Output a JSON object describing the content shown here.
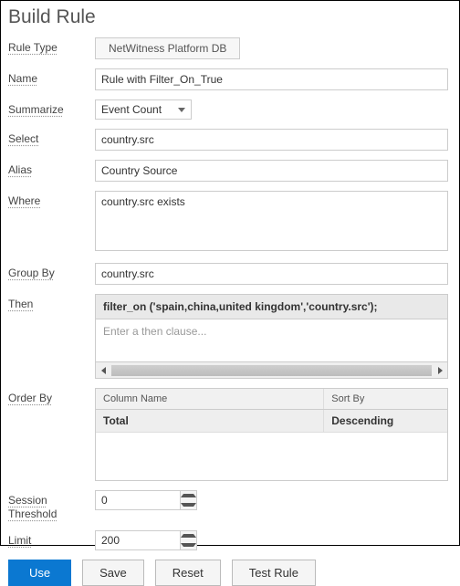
{
  "title": "Build Rule",
  "labels": {
    "ruleType": "Rule Type",
    "name": "Name",
    "summarize": "Summarize",
    "select": "Select",
    "alias": "Alias",
    "where": "Where",
    "groupBy": "Group By",
    "then": "Then",
    "orderBy": "Order By",
    "sessionThreshold": "Session Threshold",
    "limit": "Limit"
  },
  "fields": {
    "ruleType": "NetWitness Platform DB",
    "name": "Rule with Filter_On_True",
    "summarize": "Event Count",
    "select": "country.src",
    "alias": "Country Source",
    "where": "country.src exists",
    "groupBy": "country.src",
    "thenFilter": "filter_on ('spain,china,united kingdom','country.src');",
    "thenPlaceholder": "Enter a then clause...",
    "sessionThreshold": "0",
    "limit": "200"
  },
  "orderBy": {
    "colHeader": "Column Name",
    "sortHeader": "Sort By",
    "col": "Total",
    "sort": "Descending"
  },
  "buttons": {
    "use": "Use",
    "save": "Save",
    "reset": "Reset",
    "testRule": "Test Rule"
  }
}
